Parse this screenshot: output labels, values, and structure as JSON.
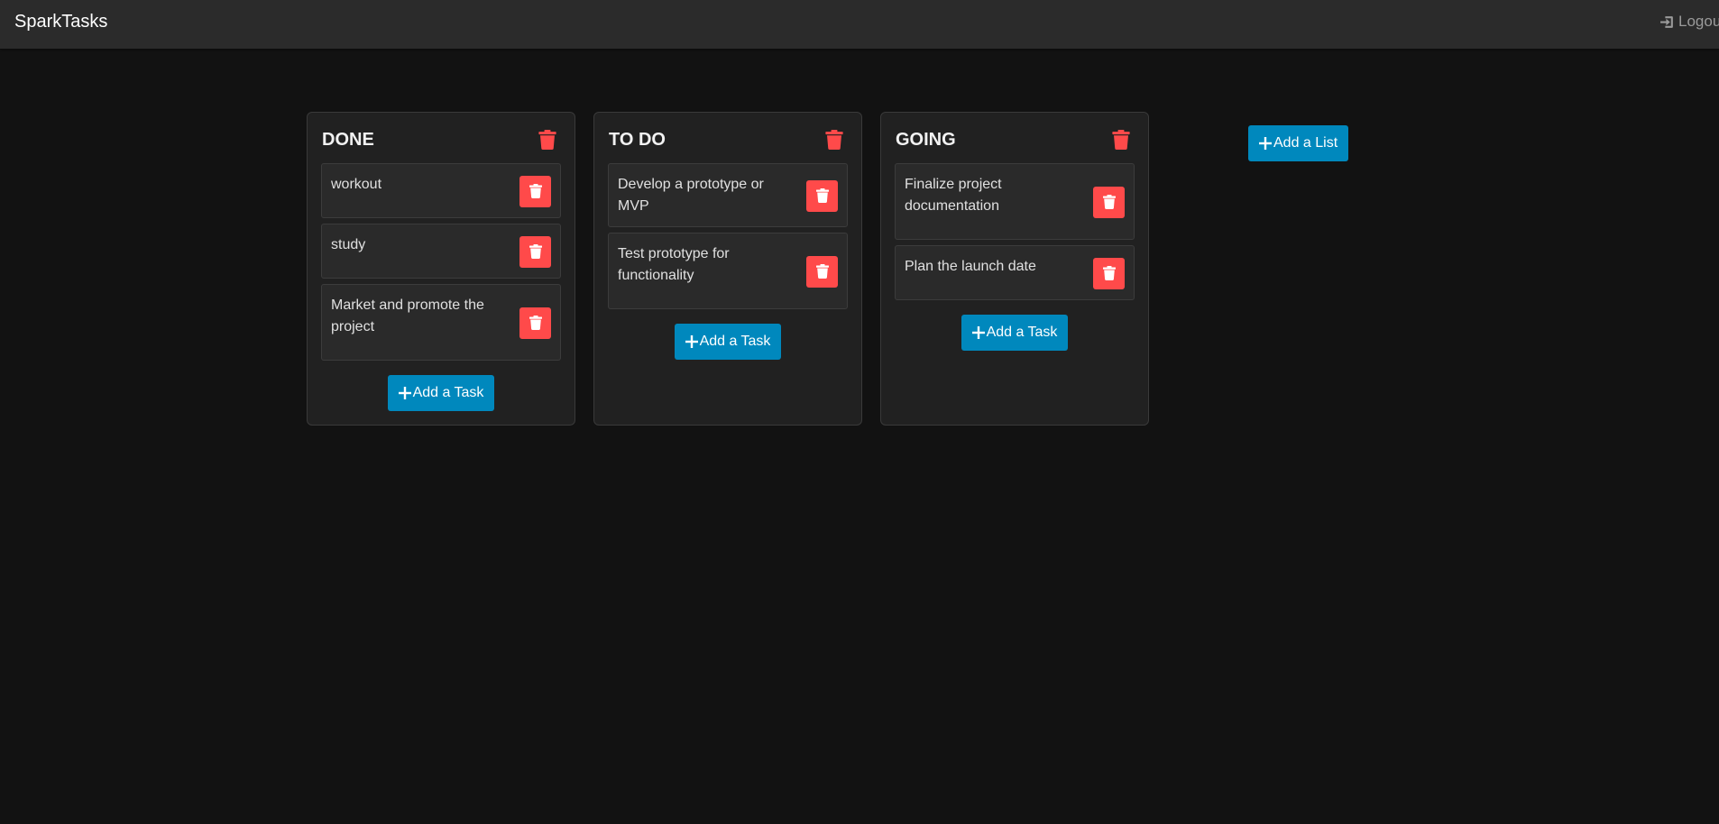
{
  "app": {
    "title": "SparkTasks",
    "logout_label": "Logout"
  },
  "lists": [
    {
      "title": "DONE",
      "tasks": [
        {
          "text": "workout"
        },
        {
          "text": "study"
        },
        {
          "text": "Market and promote the project"
        }
      ],
      "add_task_label": "Add a Task"
    },
    {
      "title": "TO DO",
      "tasks": [
        {
          "text": "Develop a prototype or MVP"
        },
        {
          "text": "Test prototype for functionality"
        }
      ],
      "add_task_label": "Add a Task"
    },
    {
      "title": "GOING",
      "tasks": [
        {
          "text": "Finalize project documentation"
        },
        {
          "text": "Plan the launch date"
        }
      ],
      "add_task_label": "Add a Task"
    }
  ],
  "add_list_label": "Add a List",
  "icons": {
    "trash": "trash-icon",
    "plus": "plus-icon",
    "logout": "sign-in-icon"
  },
  "colors": {
    "background": "#121212",
    "navbar": "#2b2b2b",
    "list_bg": "#212121",
    "task_bg": "#2a2a2a",
    "danger": "#ff4a4a",
    "primary": "#0088bd"
  }
}
